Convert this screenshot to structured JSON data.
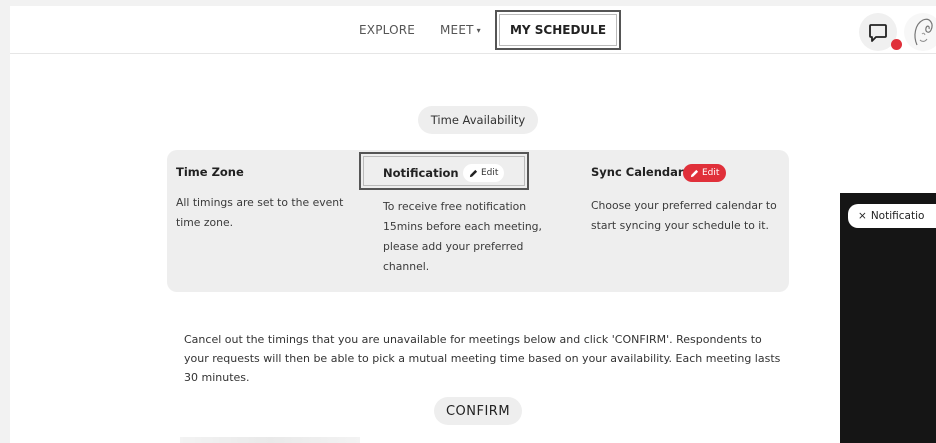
{
  "nav": {
    "items": [
      {
        "label": "EXPLORE"
      },
      {
        "label": "MEET",
        "caret": "▾"
      },
      {
        "label": "MY SCHEDULE",
        "active": true
      }
    ]
  },
  "header": {
    "chat_icon": "chat-bubble-icon",
    "avatar": "user-avatar",
    "status_color": "#e0303a"
  },
  "section": {
    "label": "Time Availability"
  },
  "card": {
    "timezone": {
      "title": "Time Zone",
      "text": "All timings are set to the event time zone."
    },
    "notification": {
      "title": "Notification",
      "edit_label": "Edit",
      "text": "To receive free notification 15mins before each meeting, please add your preferred channel."
    },
    "sync": {
      "title": "Sync Calendar",
      "edit_label": "Edit",
      "edit_color": "#e0303a",
      "text": "Choose your preferred calendar to start syncing your schedule to it."
    }
  },
  "instructions": "Cancel out the timings that you are unavailable for meetings below and click 'CONFIRM'. Respondents to your requests will then be able to pick a mutual meeting time based on your availability. Each meeting lasts 30 minutes.",
  "confirm_label": "CONFIRM",
  "toast": {
    "close": "×",
    "label": "Notificatio"
  }
}
